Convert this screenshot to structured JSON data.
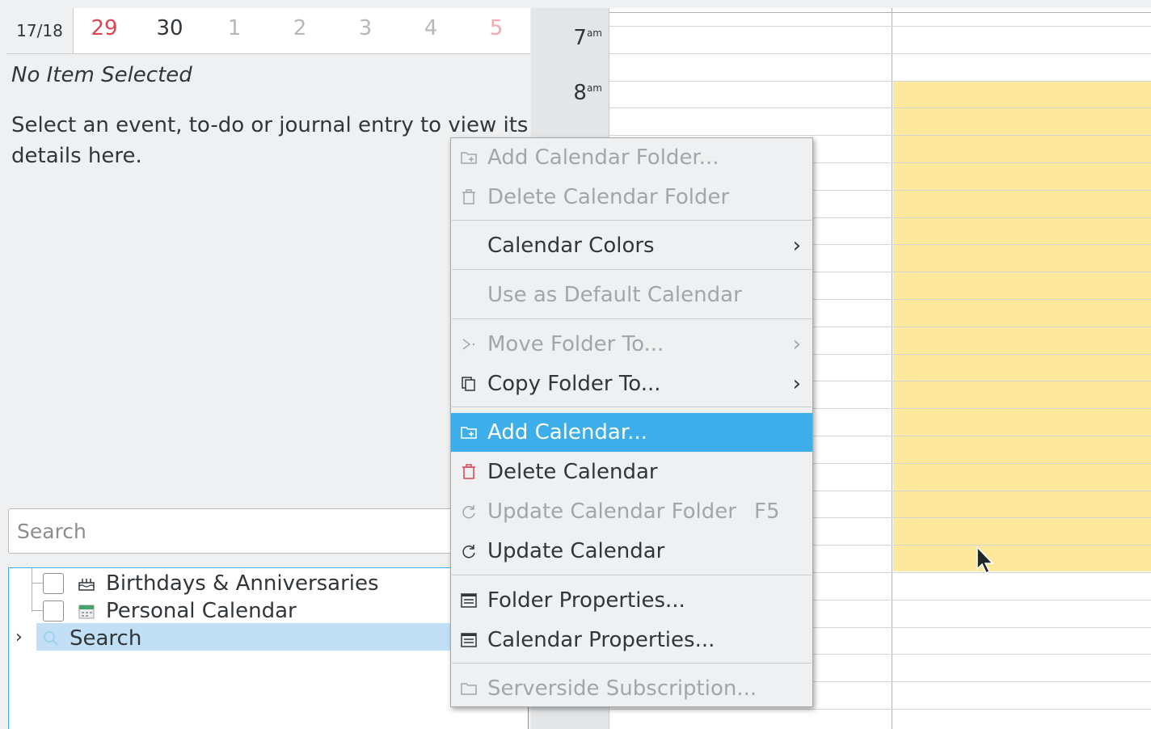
{
  "date_strip": {
    "week": "17/18",
    "days": [
      {
        "label": "29",
        "color": "#da4453"
      },
      {
        "label": "30",
        "color": "#31363b"
      },
      {
        "label": "1",
        "color": "#b6b9bc"
      },
      {
        "label": "2",
        "color": "#b6b9bc"
      },
      {
        "label": "3",
        "color": "#b6b9bc"
      },
      {
        "label": "4",
        "color": "#b6b9bc"
      },
      {
        "label": "5",
        "color": "#f3a9b1"
      }
    ]
  },
  "info_panel": {
    "title": "No Item Selected",
    "hint": "Select an event, to-do or journal entry to view its details here."
  },
  "search": {
    "placeholder": "Search"
  },
  "calendar_tree": [
    {
      "label": "Birthdays & Anniversaries",
      "icon": "cake-icon",
      "checked": false
    },
    {
      "label": "Personal Calendar",
      "icon": "calendar-icon",
      "checked": false
    },
    {
      "label": "Search",
      "icon": "search-icon",
      "selected": true,
      "expandable": true
    }
  ],
  "time_gutter": [
    {
      "hour": "7",
      "suffix": "am"
    },
    {
      "hour": "8",
      "suffix": "am"
    }
  ],
  "context_menu": {
    "items": [
      {
        "label": "Add Calendar Folder...",
        "icon": "add-folder-icon",
        "enabled": false
      },
      {
        "label": "Delete Calendar Folder",
        "icon": "trash-icon",
        "enabled": false
      },
      {
        "label": "Calendar Colors",
        "submenu": true,
        "enabled": true
      },
      {
        "label": "Use as Default Calendar",
        "enabled": false
      },
      {
        "label": "Move Folder To...",
        "icon": "move-icon",
        "submenu": true,
        "enabled": false
      },
      {
        "label": "Copy Folder To...",
        "icon": "copy-icon",
        "submenu": true,
        "enabled": true
      },
      {
        "label": "Add Calendar...",
        "icon": "add-folder-icon",
        "enabled": true,
        "highlighted": true
      },
      {
        "label": "Delete Calendar",
        "icon": "trash-icon",
        "enabled": true
      },
      {
        "label": "Update Calendar Folder",
        "icon": "refresh-icon",
        "shortcut": "F5",
        "enabled": false
      },
      {
        "label": "Update Calendar",
        "icon": "refresh-icon",
        "enabled": true
      },
      {
        "label": "Folder Properties...",
        "icon": "properties-icon",
        "enabled": true
      },
      {
        "label": "Calendar Properties...",
        "icon": "properties-icon",
        "enabled": true
      },
      {
        "label": "Serverside Subscription...",
        "icon": "folder-icon",
        "enabled": false
      }
    ]
  },
  "colors": {
    "accent": "#3daee9",
    "busy_block": "#fde89b",
    "delete_icon": "#da4453"
  }
}
